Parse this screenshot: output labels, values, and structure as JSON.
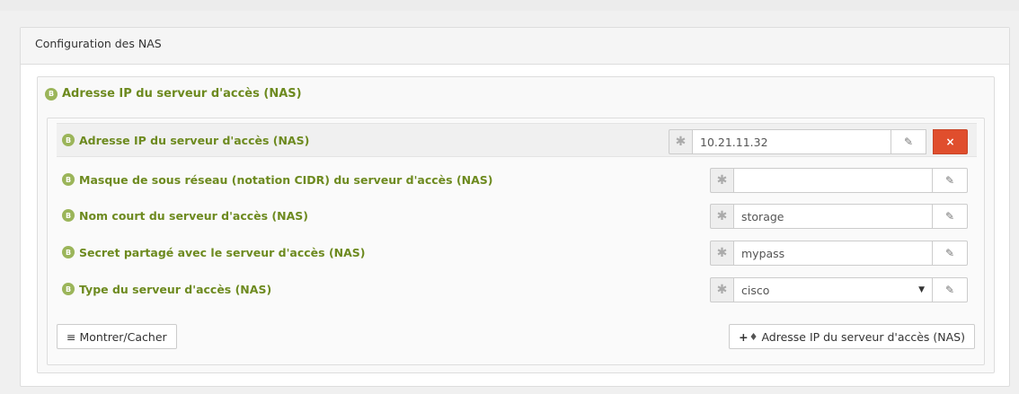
{
  "panel": {
    "title": "Configuration des NAS"
  },
  "family": {
    "badge": "B",
    "title": "Adresse IP du serveur d'accès (NAS)"
  },
  "rows": [
    {
      "badge": "B",
      "label": "Adresse IP du serveur d'accès (NAS)",
      "value": "10.21.11.32",
      "required": "✱"
    },
    {
      "badge": "B",
      "label": "Masque de sous réseau (notation CIDR) du serveur d'accès (NAS)",
      "value": "",
      "required": "✱"
    },
    {
      "badge": "B",
      "label": "Nom court du serveur d'accès (NAS)",
      "value": "storage",
      "required": "✱"
    },
    {
      "badge": "B",
      "label": "Secret partagé avec le serveur d'accès (NAS)",
      "value": "mypass",
      "required": "✱"
    },
    {
      "badge": "B",
      "label": "Type du serveur d'accès (NAS)",
      "value": "cisco",
      "required": "✱"
    }
  ],
  "buttons": {
    "toggle_label": "Montrer/Cacher",
    "add_label": "Adresse IP du serveur d'accès (NAS)",
    "remove_label": "×"
  },
  "colors": {
    "accent_green": "#6d8a1f",
    "badge_green": "#9bb55a",
    "danger": "#e04e2d"
  },
  "icons": [
    "asterisk-icon",
    "edit-icon",
    "remove-icon",
    "bars-icon",
    "plus-icon",
    "tag-icon",
    "caret-down-icon"
  ]
}
